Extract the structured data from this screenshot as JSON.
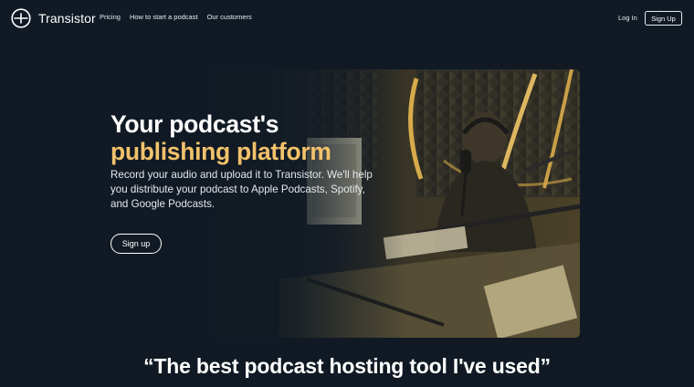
{
  "nav": {
    "brand": "Transistor",
    "links": [
      "Pricing",
      "How to start a podcast",
      "Our customers"
    ],
    "login": "Log In",
    "signup": "Sign Up"
  },
  "hero": {
    "title_line1": "Your podcast's",
    "title_line2": "publishing platform",
    "subtitle": "Record your audio and upload it to Transistor. We'll help you distribute your podcast to Apple Podcasts, Spotify, and Google Podcasts.",
    "cta": "Sign up"
  },
  "quote": "“The best podcast hosting tool I've used”",
  "colors": {
    "background": "#111a24",
    "accent": "#f2c26b"
  }
}
